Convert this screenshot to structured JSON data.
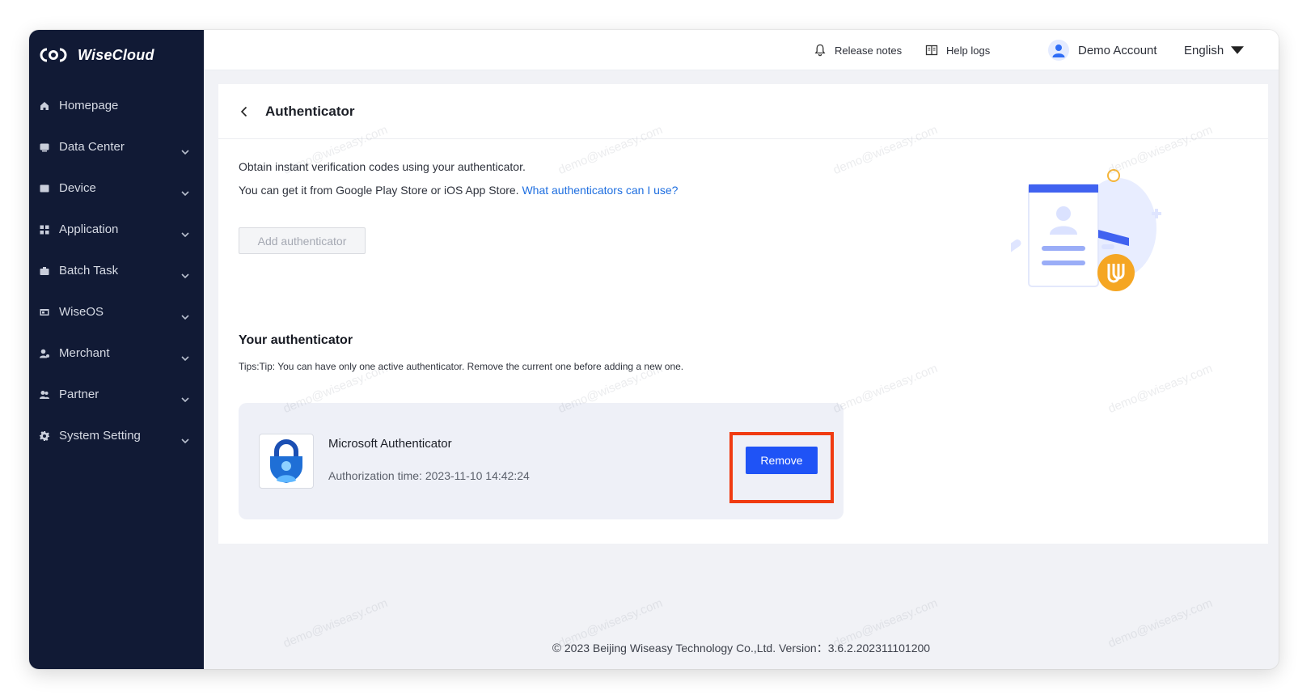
{
  "app": {
    "name": "WiseCloud"
  },
  "sidebar": {
    "items": [
      {
        "label": "Homepage",
        "icon": "home-icon",
        "expandable": false
      },
      {
        "label": "Data Center",
        "icon": "chart-icon",
        "expandable": true
      },
      {
        "label": "Device",
        "icon": "device-icon",
        "expandable": true
      },
      {
        "label": "Application",
        "icon": "apps-icon",
        "expandable": true
      },
      {
        "label": "Batch Task",
        "icon": "briefcase-icon",
        "expandable": true
      },
      {
        "label": "WiseOS",
        "icon": "os-icon",
        "expandable": true
      },
      {
        "label": "Merchant",
        "icon": "merchant-icon",
        "expandable": true
      },
      {
        "label": "Partner",
        "icon": "partner-icon",
        "expandable": true
      },
      {
        "label": "System Setting",
        "icon": "gear-icon",
        "expandable": true
      }
    ]
  },
  "topbar": {
    "release_notes": "Release notes",
    "help_logs": "Help logs",
    "account": "Demo Account",
    "language": "English"
  },
  "page": {
    "title": "Authenticator",
    "desc_line1": "Obtain instant verification codes using your authenticator.",
    "desc_line2": "You can get it from Google Play Store or iOS App Store.",
    "desc_link": "What authenticators can I use?",
    "add_button": "Add authenticator",
    "section_title": "Your authenticator",
    "tips": "Tips:Tip: You can have only one active authenticator. Remove the current one before adding a new one."
  },
  "authenticator": {
    "name": "Microsoft Authenticator",
    "auth_time": "Authorization time: 2023-11-10 14:42:24",
    "remove_button": "Remove"
  },
  "footer": {
    "copyright_symbol": "©",
    "text": "2023 Beijing Wiseasy Technology Co.,Ltd. Version：3.6.2.202311101200"
  },
  "watermark": "demo@wiseasy.com",
  "colors": {
    "sidebar_bg": "#111a35",
    "primary": "#1f53f6",
    "link": "#1f6fe0",
    "highlight": "#f03b11",
    "content_bg": "#f1f2f6"
  }
}
